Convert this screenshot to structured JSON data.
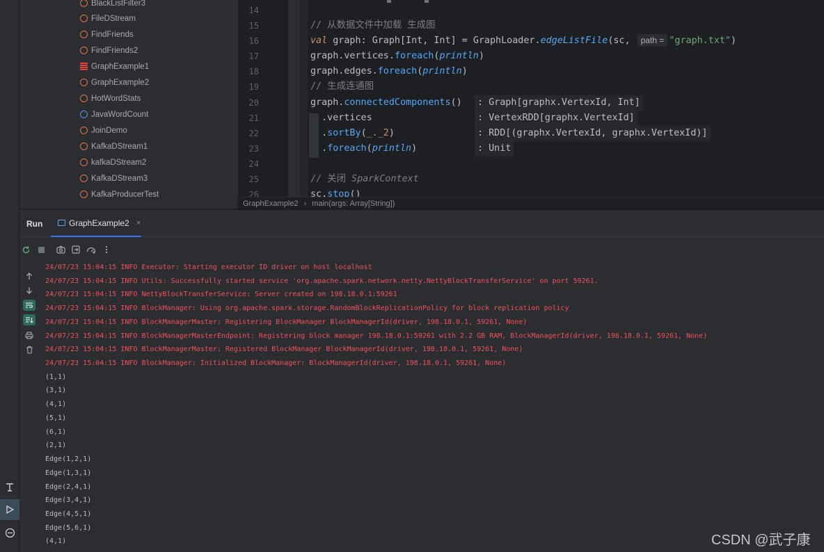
{
  "project_tree": {
    "items": [
      {
        "name": "BlackListFilter3",
        "kind": "object"
      },
      {
        "name": "FileDStream",
        "kind": "object"
      },
      {
        "name": "FindFriends",
        "kind": "object"
      },
      {
        "name": "FindFriends2",
        "kind": "object"
      },
      {
        "name": "GraphExample1",
        "kind": "scala"
      },
      {
        "name": "GraphExample2",
        "kind": "object"
      },
      {
        "name": "HotWordStats",
        "kind": "object"
      },
      {
        "name": "JavaWordCount",
        "kind": "java"
      },
      {
        "name": "JoinDemo",
        "kind": "object"
      },
      {
        "name": "KafkaDStream1",
        "kind": "object"
      },
      {
        "name": "kafkaDStream2",
        "kind": "object"
      },
      {
        "name": "KafkaDStream3",
        "kind": "object"
      },
      {
        "name": "KafkaProducerTest",
        "kind": "object"
      }
    ]
  },
  "editor": {
    "line_numbers": [
      "14",
      "15",
      "16",
      "17",
      "18",
      "19",
      "20",
      "21",
      "22",
      "23",
      "24",
      "25",
      "26"
    ],
    "lines": {
      "l15_comment": "// 从数据文件中加载 生成图",
      "l16_kw": "val",
      "l16_var": " graph",
      "l16_colon": ": ",
      "l16_type": "Graph[Int, Int]",
      "l16_eq": " = ",
      "l16_obj": "GraphLoader",
      "l16_dot": ".",
      "l16_fn": "edgeListFile",
      "l16_args": "(sc, ",
      "l16_hint": "path =",
      "l16_str": "\"graph.txt\"",
      "l16_close": ")",
      "l17_a": "graph.vertices.",
      "l17_fn": "foreach",
      "l17_p": "(",
      "l17_it": "println",
      "l17_c": ")",
      "l18_a": "graph.edges.",
      "l18_fn": "foreach",
      "l18_p": "(",
      "l18_it": "println",
      "l18_c": ")",
      "l19_comment": "// 生成连通图",
      "l20_a": "graph.",
      "l20_fn": "connectedComponents",
      "l20_c": "()",
      "l21_a": "  .vertices",
      "l22_a": "  .",
      "l22_fn": "sortBy",
      "l22_b": "(",
      "l22_u": "_._2",
      "l22_c": ")",
      "l23_a": "  .",
      "l23_fn": "foreach",
      "l23_p": "(",
      "l23_it": "println",
      "l23_c": ")",
      "l25_comment": "// 关闭 ",
      "l25_comment_it": "SparkContext",
      "l26_a": "sc.",
      "l26_fn": "stop",
      "l26_c": "()"
    },
    "type_hints": [
      ": Graph[graphx.VertexId, Int]",
      ": VertexRDD[graphx.VertexId]",
      ": RDD[(graphx.VertexId, graphx.VertexId)]",
      ": Unit"
    ]
  },
  "breadcrumbs": [
    "GraphExample2",
    "main(args: Array[String])"
  ],
  "breadcrumb_sep": "›",
  "run_panel": {
    "title": "Run",
    "tab_label": "GraphExample2",
    "tab_close": "×"
  },
  "console": {
    "error_lines": [
      "24/07/23 15:04:15 INFO Executor: Starting executor ID driver on host localhost",
      "24/07/23 15:04:15 INFO Utils: Successfully started service 'org.apache.spark.network.netty.NettyBlockTransferService' on port 59261.",
      "24/07/23 15:04:15 INFO NettyBlockTransferService: Server created on 198.18.0.1:59261",
      "24/07/23 15:04:15 INFO BlockManager: Using org.apache.spark.storage.RandomBlockReplicationPolicy for block replication policy",
      "24/07/23 15:04:15 INFO BlockManagerMaster: Registering BlockManager BlockManagerId(driver, 198.18.0.1, 59261, None)",
      "24/07/23 15:04:15 INFO BlockManagerMasterEndpoint: Registering block manager 198.18.0.1:59261 with 2.2 GB RAM, BlockManagerId(driver, 198.18.0.1, 59261, None)",
      "24/07/23 15:04:15 INFO BlockManagerMaster: Registered BlockManager BlockManagerId(driver, 198.18.0.1, 59261, None)",
      "24/07/23 15:04:15 INFO BlockManager: Initialized BlockManager: BlockManagerId(driver, 198.18.0.1, 59261, None)"
    ],
    "output_lines": [
      "(1,1)",
      "(3,1)",
      "(4,1)",
      "(5,1)",
      "(6,1)",
      "(2,1)",
      "Edge(1,2,1)",
      "Edge(1,3,1)",
      "Edge(2,4,1)",
      "Edge(3,4,1)",
      "Edge(4,5,1)",
      "Edge(5,6,1)",
      "(4,1)"
    ]
  },
  "watermark": "CSDN @武子康",
  "colors": {
    "error_text": "#f0525e",
    "accent": "#3574f0",
    "keyword": "#cf8e6d",
    "function": "#56a8f5",
    "string": "#6aab73",
    "comment": "#7a7e85"
  },
  "icons": {
    "activity": [
      "structure-icon",
      "run-icon",
      "services-icon"
    ],
    "toolbar": [
      "rerun-icon",
      "stop-icon",
      "screenshot-icon",
      "export-icon",
      "profiler-icon",
      "more-icon"
    ],
    "side": [
      "up-arrow-icon",
      "down-arrow-icon",
      "soft-wrap-icon",
      "scroll-to-end-icon",
      "print-icon",
      "trash-icon"
    ]
  }
}
